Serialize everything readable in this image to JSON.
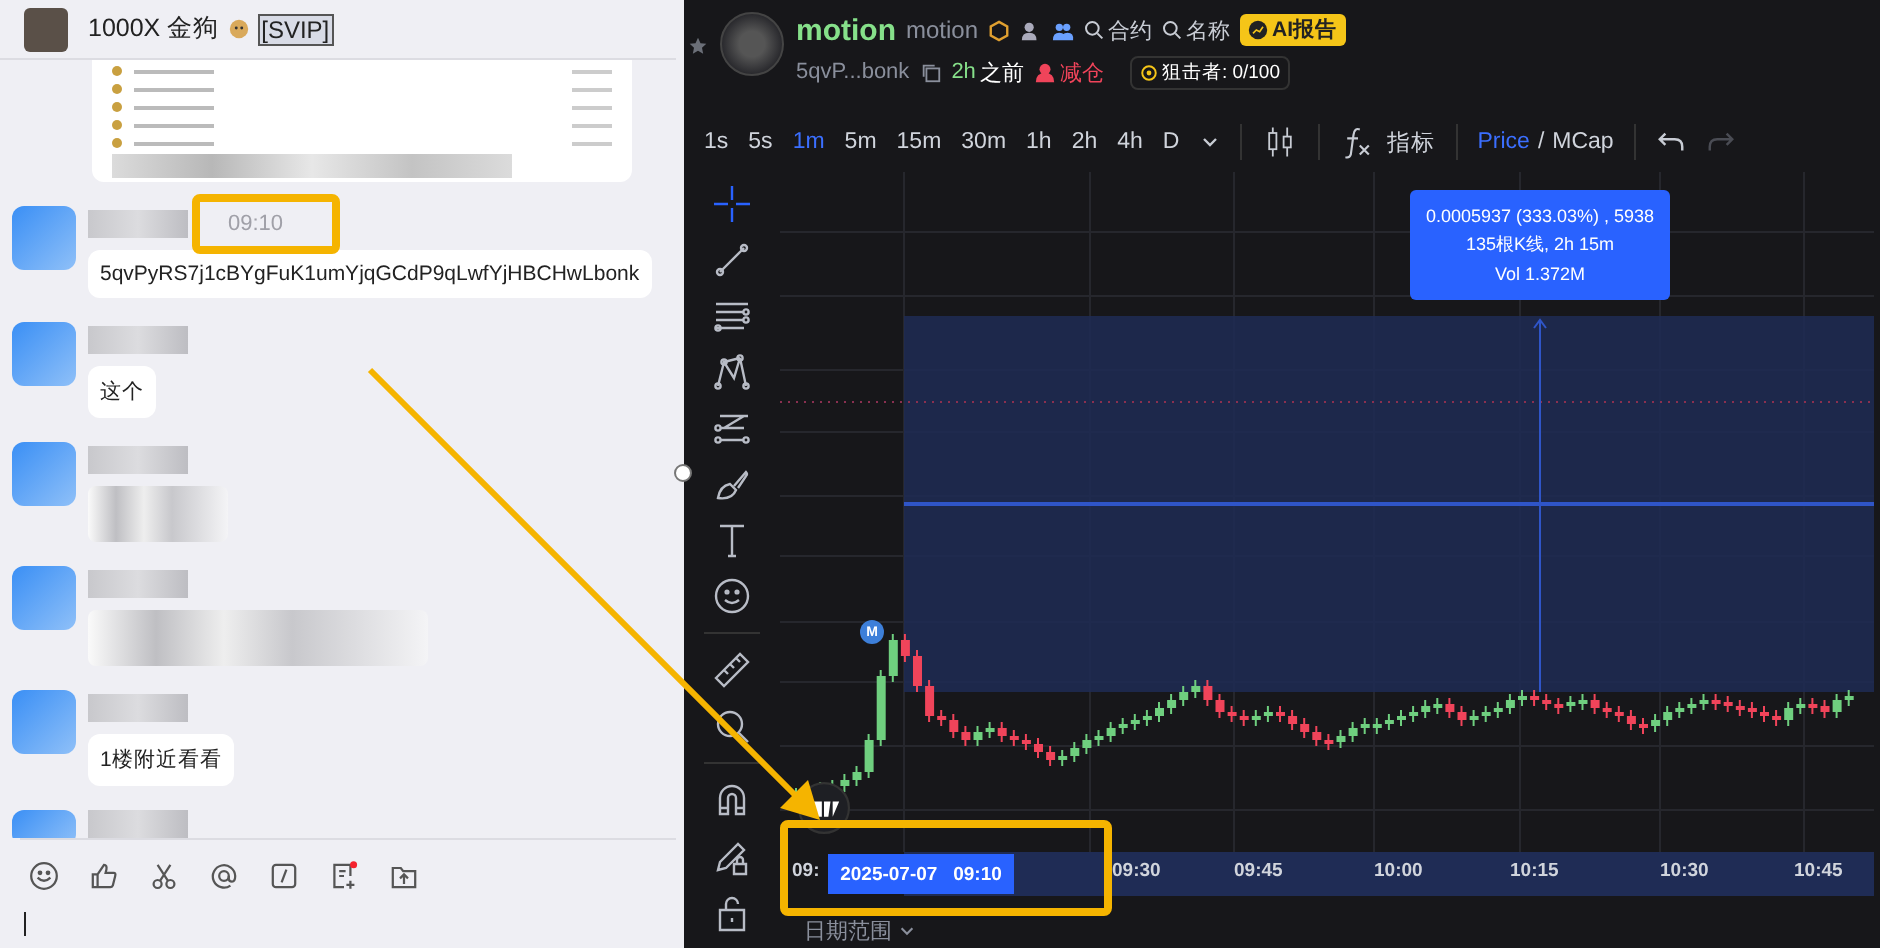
{
  "chat": {
    "title": "1000X 金狗",
    "title_badge": "[SVIP]",
    "messages": [
      {
        "kind": "image"
      },
      {
        "kind": "text",
        "time": "09:10",
        "text": "5qvPyRS7j1cBYgFuK1umYjqGCdP9qLwfYjHBCHwLbonk"
      },
      {
        "kind": "text",
        "text": "这个"
      },
      {
        "kind": "blurred"
      },
      {
        "kind": "blurred"
      },
      {
        "kind": "text",
        "text": "1楼附近看看"
      },
      {
        "kind": "partial"
      }
    ]
  },
  "token": {
    "name": "motion",
    "symbol": "motion",
    "actions": [
      "合约",
      "名称"
    ],
    "ai_badge": "AI报告",
    "address": "5qvP...bonk",
    "age_value": "2h",
    "age_suffix": "之前",
    "trade_tag": "减仓",
    "sniper": "狙击者: 0/100"
  },
  "toolbar": {
    "intervals": [
      {
        "label": "1s",
        "selected": false
      },
      {
        "label": "5s",
        "selected": false
      },
      {
        "label": "1m",
        "selected": true
      },
      {
        "label": "5m",
        "selected": false
      },
      {
        "label": "15m",
        "selected": false
      },
      {
        "label": "30m",
        "selected": false
      },
      {
        "label": "1h",
        "selected": false
      },
      {
        "label": "2h",
        "selected": false
      },
      {
        "label": "4h",
        "selected": false
      },
      {
        "label": "D",
        "selected": false
      }
    ],
    "indicators": "指标",
    "price_modes": [
      {
        "label": "Price",
        "selected": true
      },
      {
        "label": "MCap",
        "selected": false
      }
    ],
    "mode_separator": "/",
    "history": [
      {
        "kind": "undo",
        "disabled": false
      },
      {
        "kind": "redo",
        "disabled": true
      }
    ]
  },
  "chart": {
    "tooltip": [
      "0.0005937 (333.03%) , 5938",
      "135根K线, 2h 15m",
      "Vol 1.372M"
    ],
    "marker": "M",
    "time_labels": [
      "09:",
      "09:30",
      "09:45",
      "10:00",
      "10:15",
      "10:30",
      "10:45"
    ],
    "crosshair_date": "2025-07-07",
    "crosshair_time": "09:10",
    "date_range": "日期范围"
  }
}
